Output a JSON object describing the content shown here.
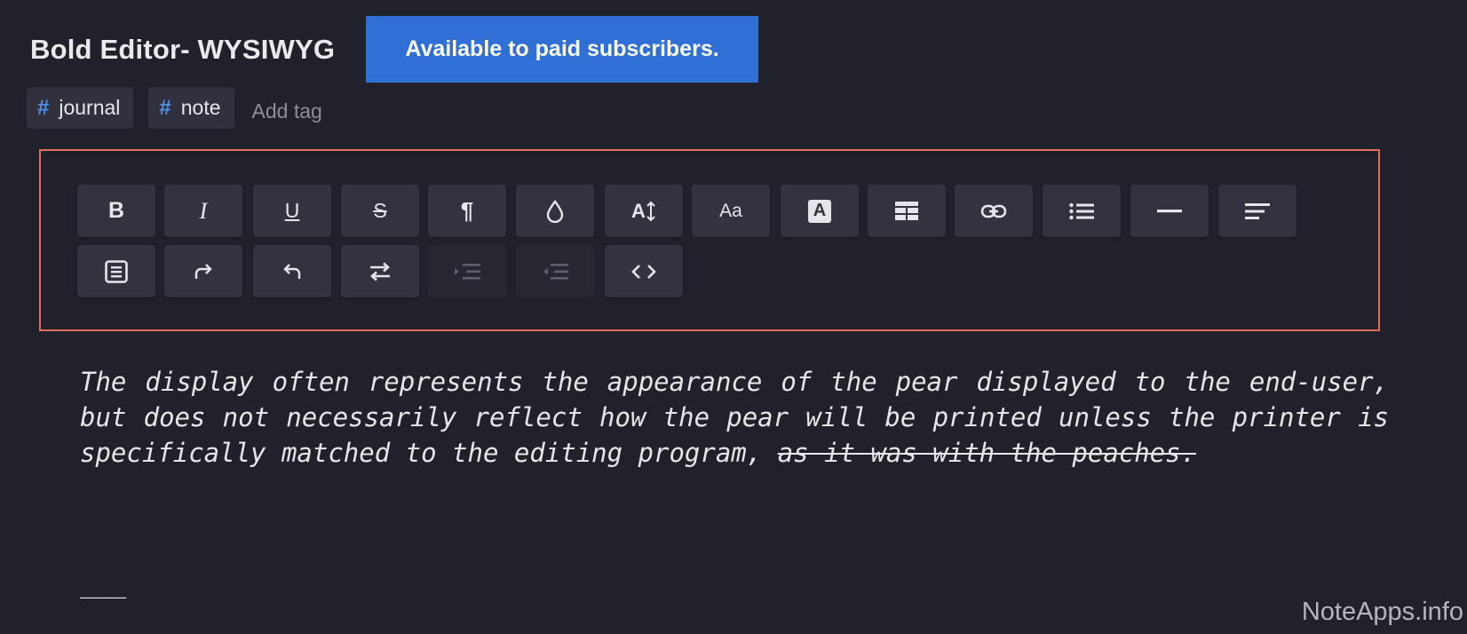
{
  "header": {
    "title": "Bold Editor- WYSIWYG",
    "banner": "Available to paid subscribers."
  },
  "tags": {
    "items": [
      {
        "label": "journal"
      },
      {
        "label": "note"
      }
    ],
    "add_label": "Add tag"
  },
  "toolbar": {
    "row1": [
      {
        "icon": "bold-icon",
        "glyph": "B"
      },
      {
        "icon": "italic-icon",
        "glyph": "I"
      },
      {
        "icon": "underline-icon",
        "glyph": "U"
      },
      {
        "icon": "strikethrough-icon",
        "glyph": "S"
      },
      {
        "icon": "paragraph-icon",
        "glyph": "¶"
      },
      {
        "icon": "text-color-drop-icon"
      },
      {
        "icon": "font-size-icon",
        "glyph": "A"
      },
      {
        "icon": "font-family-icon",
        "glyph": "Aa"
      },
      {
        "icon": "highlight-icon",
        "glyph": "A"
      },
      {
        "icon": "table-icon"
      },
      {
        "icon": "link-icon"
      },
      {
        "icon": "bullet-list-icon"
      },
      {
        "icon": "horizontal-rule-icon"
      },
      {
        "icon": "align-left-icon"
      }
    ],
    "row2": [
      {
        "icon": "document-icon"
      },
      {
        "icon": "redo-icon"
      },
      {
        "icon": "undo-icon"
      },
      {
        "icon": "direction-swap-icon"
      },
      {
        "icon": "indent-icon",
        "disabled": true
      },
      {
        "icon": "outdent-icon",
        "disabled": true
      },
      {
        "icon": "code-icon"
      }
    ]
  },
  "content": {
    "body_text": "The display often represents the appearance of the pear displayed to the end-user, but does not necessarily reflect how the pear will be printed unless the printer is specifically matched to the editing program, ",
    "strike_text": "as it was with the peaches.",
    "hr_markdown": "___"
  },
  "watermark": "NoteApps.info",
  "colors": {
    "background": "#21212b",
    "banner": "#2f6fd6",
    "toolbar_border": "#e0705e",
    "tag_hash": "#4f8fe8"
  }
}
